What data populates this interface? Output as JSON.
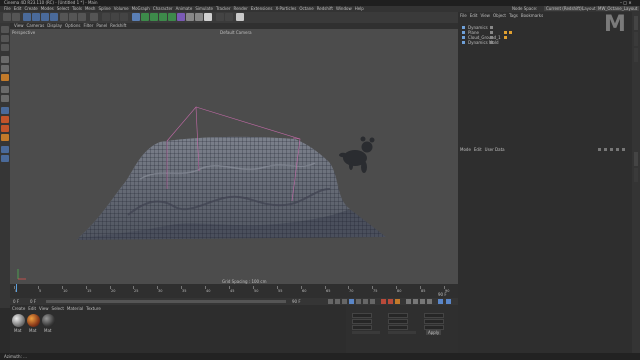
{
  "window": {
    "title": "Cinema 4D R23.110 (RC) - [Untitled 1 *] - Main"
  },
  "menu": [
    "File",
    "Edit",
    "Create",
    "Modes",
    "Select",
    "Tools",
    "Mesh",
    "Spline",
    "Volume",
    "MoGraph",
    "Character",
    "Animate",
    "Simulate",
    "Tracker",
    "Render",
    "Extensions",
    "X-Particles",
    "Octane",
    "Redshift",
    "Window",
    "Help"
  ],
  "topright": {
    "node_space_label": "Node Space:",
    "node_space_value": "Current (Redshift)",
    "layout_label": "Layout:",
    "layout_value": "MW_Octane_Layout"
  },
  "viewport": {
    "menu": [
      "View",
      "Cameras",
      "Display",
      "Options",
      "Filter",
      "Panel",
      "Redshift"
    ],
    "perspective_label": "Perspective",
    "camera_label": "Default Camera",
    "grid_spacing": "Grid Spacing : 100 cm"
  },
  "timeline": {
    "ticks": [
      "0",
      "5",
      "10",
      "15",
      "20",
      "25",
      "30",
      "35",
      "40",
      "45",
      "50",
      "55",
      "60",
      "65",
      "70",
      "75",
      "80",
      "85",
      "90"
    ],
    "frame_end": "90 F",
    "frame_start": "0 F",
    "current_frame": "0 F"
  },
  "objects": {
    "menu": [
      "File",
      "Edit",
      "View",
      "Object",
      "Tags",
      "Bookmarks"
    ],
    "items": [
      "Dynamics",
      "Plane",
      "Cloud_Ground_1",
      "Dynamics Mold"
    ],
    "color_accent": "#e0a030"
  },
  "attributes": {
    "menu": [
      "Mode",
      "Edit",
      "User Data"
    ]
  },
  "materials": {
    "menu": [
      "Create",
      "Edit",
      "View",
      "Select",
      "Material",
      "Texture"
    ],
    "names": [
      "Mat",
      "Mat",
      "Mat"
    ]
  },
  "coordinates": {
    "apply_label": "Apply"
  },
  "status": {
    "text": "Azimuth: ..."
  },
  "watermark": "M"
}
